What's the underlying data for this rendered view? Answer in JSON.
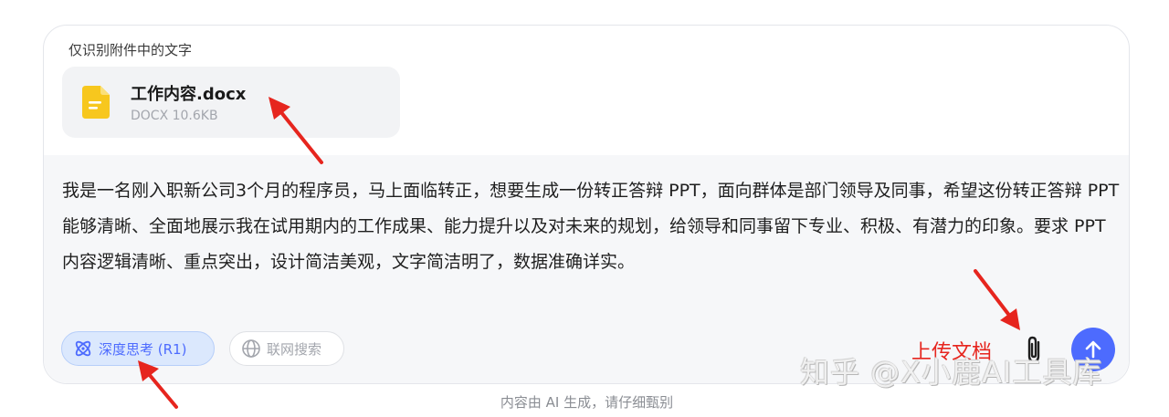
{
  "attachment_section": {
    "mode_label": "仅识别附件中的文字",
    "file": {
      "name": "工作内容.docx",
      "meta": "DOCX 10.6KB",
      "icon": "document-icon",
      "icon_color": "#f7c71e"
    }
  },
  "prompt": {
    "text": "我是一名刚入职新公司3个月的程序员，马上面临转正，想要生成一份转正答辩 PPT，面向群体是部门领导及同事，希望这份转正答辩 PPT 能够清晰、全面地展示我在试用期内的工作成果、能力提升以及对未来的规划，给领导和同事留下专业、积极、有潜力的印象。要求 PPT 内容逻辑清晰、重点突出，设计简洁美观，文字简洁明了，数据准确详实。"
  },
  "toolbar": {
    "deep_think_label": "深度思考 (R1)",
    "deep_think_active": true,
    "web_search_label": "联网搜索",
    "web_search_active": false,
    "attach_icon": "paperclip-icon",
    "send_icon": "arrow-up-icon",
    "accent_color": "#4d6bfe"
  },
  "annotations": {
    "upload_label": "上传文档",
    "arrow_color": "#e6251e"
  },
  "watermark": "知乎 @X小鹿AI工具库",
  "footer": {
    "disclaimer": "内容由 AI 生成，请仔细甄别"
  }
}
